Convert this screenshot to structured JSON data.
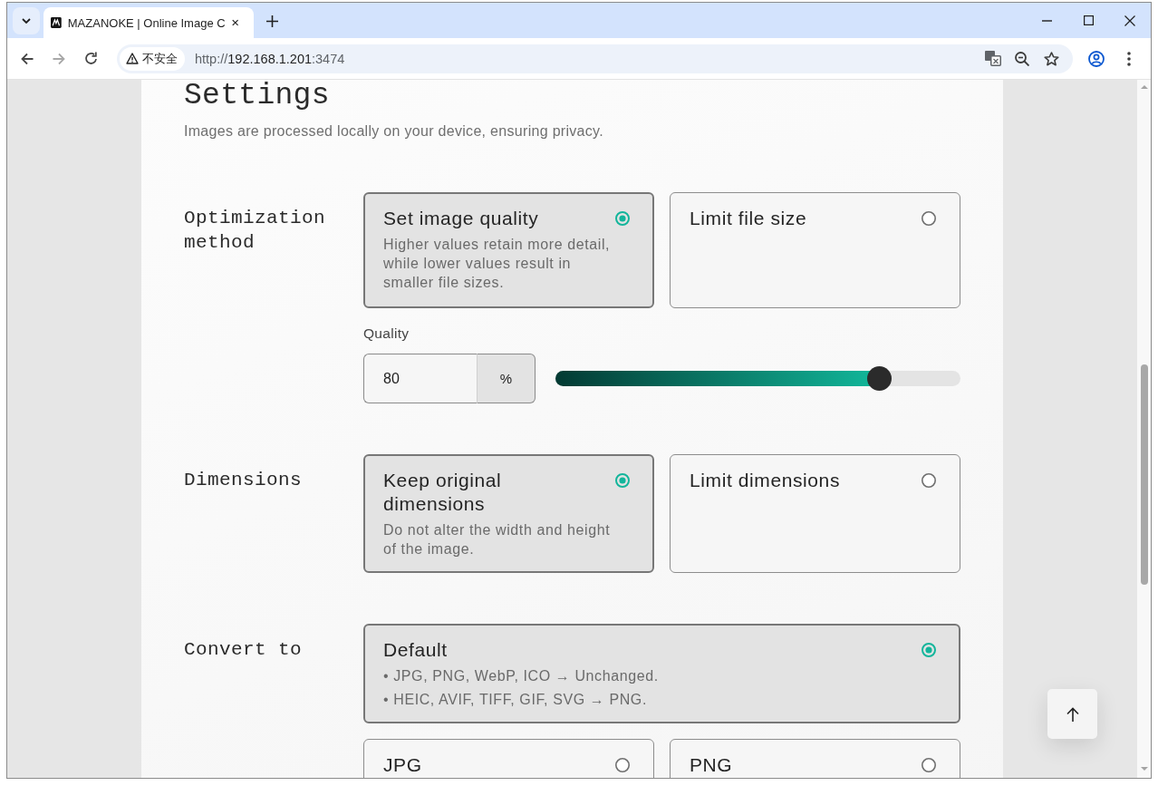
{
  "browser": {
    "tab": {
      "title": "MAZANOKE | Online Image C",
      "selected": true
    },
    "nav_buttons": [
      {
        "kind": "back",
        "disabled": false
      },
      {
        "kind": "forward",
        "disabled": true
      },
      {
        "kind": "reload",
        "disabled": false
      }
    ],
    "address_bar": {
      "security_label": "不安全",
      "url": {
        "scheme": "http://",
        "host": "192.168.1.201",
        "port": ":3474"
      }
    }
  },
  "page": {
    "title": "Settings",
    "subtitle": "Images are processed locally on your device, ensuring privacy.",
    "sections": [
      {
        "label": "Optimization method",
        "options": [
          {
            "title": "Set image quality",
            "description": [
              "Higher values retain more detail, while lower values result in smaller file sizes."
            ],
            "selected": true
          },
          {
            "title": "Limit file size",
            "selected": false
          }
        ],
        "quality": {
          "label": "Quality",
          "value": "80",
          "unit": "%",
          "level": 0.8
        }
      },
      {
        "label": "Dimensions",
        "options": [
          {
            "title": "Keep original dimensions",
            "description": [
              "Do not alter the width and height of the image."
            ],
            "selected": true
          },
          {
            "title": "Limit dimensions",
            "selected": false
          }
        ]
      },
      {
        "label": "Convert to",
        "options": [
          {
            "title": "Default",
            "description": [
              "• JPG, PNG, WebP, ICO → Unchanged.",
              "• HEIC, AVIF, TIFF, GIF, SVG → PNG."
            ],
            "selected": true,
            "wide": true
          },
          {
            "title": "JPG",
            "selected": false,
            "wide": false
          },
          {
            "title": "PNG",
            "selected": false,
            "wide": false
          }
        ]
      }
    ]
  }
}
